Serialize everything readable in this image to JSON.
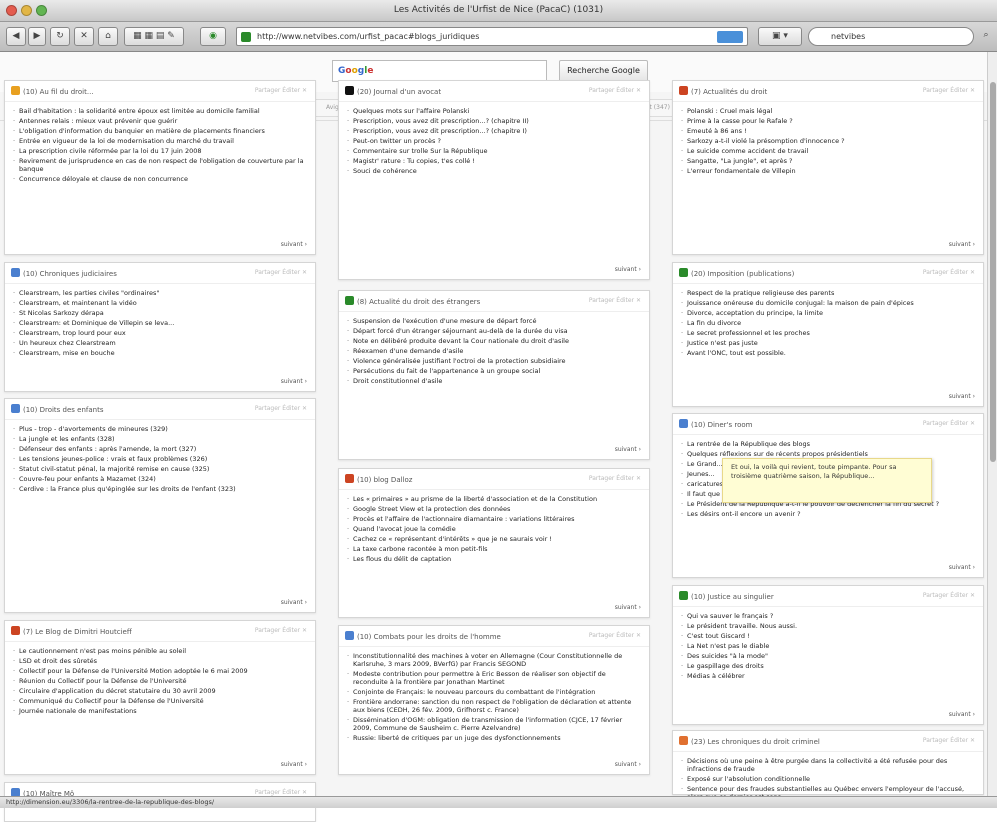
{
  "window": {
    "title": "Les Activités de l'Urfist de Nice (PacaC) (1031)"
  },
  "browser": {
    "url": "http://www.netvibes.com/urfist_pacac#blogs_juridiques",
    "search": "netvibes"
  },
  "google": {
    "placeholder": "Google",
    "button": "Recherche Google"
  },
  "tabs": [
    "Accueil (73)",
    "SIG (26)",
    "SPI (93)",
    "SHS (198)",
    "Marseille 1",
    "Nice",
    "Marseille",
    "Avignon",
    "Toulon",
    "Corte",
    "blogs_juridiques (303)",
    "droit (347)",
    "+"
  ],
  "tab_edit": "Éditer",
  "widgets": [
    {
      "title": "(10) Au fil du droit...",
      "items": [
        "Bail d'habitation : la solidarité entre époux est limitée au domicile familial",
        "Antennes relais : mieux vaut prévenir que guérir",
        "L'obligation d'information du banquier en matière de placements financiers",
        "Entrée en vigueur de la loi de modernisation du marché du travail",
        "La prescription civile réformée par la loi du 17 juin 2008",
        "Revirement de jurisprudence en cas de non respect de l'obligation de couverture par la banque",
        "Concurrence déloyale et clause de non concurrence"
      ]
    },
    {
      "title": "(10) Chroniques judiciaires",
      "items": [
        "Clearstream, les parties civiles \"ordinaires\"",
        "Clearstream, et maintenant la vidéo",
        "St Nicolas Sarkozy dérapa",
        "Clearstream: et Dominique de Villepin se leva...",
        "Clearstream, trop lourd pour eux",
        "Un heureux chez Clearstream",
        "Clearstream, mise en bouche"
      ]
    },
    {
      "title": "(10) Droits des enfants",
      "items": [
        "Plus - trop - d'avortements de mineures (329)",
        "La jungle et les enfants (328)",
        "Défenseur des enfants : après l'amende, la mort (327)",
        "Les tensions jeunes-police : vrais et faux problèmes (326)",
        "Statut civil-statut pénal, la majorité remise en cause (325)",
        "Couvre-feu pour enfants à Mazamet (324)",
        "Cerdive : la France plus qu'épinglée sur les droits de l'enfant (323)"
      ]
    },
    {
      "title": "(7) Le Blog de Dimitri Houtcieff",
      "items": [
        "Le cautionnement n'est pas moins pénible au soleil",
        "LSD et droit des sûretés",
        "Collectif pour la Défense de l'Université Motion adoptée le 6 mai 2009",
        "Réunion du Collectif pour la Défense de l'Université",
        "Circulaire d'application du décret statutaire du 30 avril 2009",
        "Communiqué du Collectif pour la Défense de l'Université",
        "Journée nationale de manifestations"
      ]
    },
    {
      "title": "(20) Journal d'un avocat",
      "items": [
        "Quelques mots sur l'affaire Polanski",
        "Prescription, vous avez dit prescription...? (chapitre II)",
        "Prescription, vous avez dit prescription...? (chapitre I)",
        "Peut-on twitter un procès ?",
        "Commentaire sur trolle Sur la République",
        "Magistr' rature : Tu copies, t'es collé !",
        "Souci de cohérence"
      ]
    },
    {
      "title": "(8) Actualité du droit des étrangers",
      "items": [
        "Suspension de l'exécution d'une mesure de départ forcé",
        "Départ forcé d'un étranger séjournant au-delà de la durée du visa",
        "Note en délibéré produite devant la Cour nationale du droit d'asile",
        "Réexamen d'une demande d'asile",
        "Violence généralisée justifiant l'octroi de la protection subsidiaire",
        "Persécutions du fait de l'appartenance à un groupe social",
        "Droit constitutionnel d'asile"
      ]
    },
    {
      "title": "(10) blog Dalloz",
      "items": [
        "Les « primaires » au prisme de la liberté d'association et de la Constitution",
        "Google Street View et la protection des données",
        "Procès et l'affaire de l'actionnaire diamantaire : variations littéraires",
        "Quand l'avocat joue la comédie",
        "Cachez ce « représentant d'intérêts » que je ne saurais voir !",
        "La taxe carbone racontée à mon petit-fils",
        "Les flous du délit de captation"
      ]
    },
    {
      "title": "(10) Combats pour les droits de l'homme",
      "items": [
        "Inconstitutionnalité des machines à voter en Allemagne (Cour Constitutionnelle de Karlsruhe, 3 mars 2009, BVerfG) par Francis SEGOND",
        "Modeste contribution pour permettre à Eric Besson de réaliser son objectif de reconduite à la frontière par Jonathan Martinet",
        "Conjointe de Français: le nouveau parcours du combattant de l'intégration",
        "Frontière andorrane: sanction du non respect de l'obligation de déclaration et attente aux biens (CEDH, 26 fév. 2009, Grifhorst c. France)",
        "Dissémination d'OGM: obligation de transmission de l'information (CJCE, 17 février 2009, Commune de Sausheim c. Pierre Azelvandre)",
        "Russie: liberté de critiques par un juge des dysfonctionnements"
      ]
    },
    {
      "title": "(7) Actualités du droit",
      "items": [
        "Polanski : Cruel mais légal",
        "Prime à la casse pour le Rafale ?",
        "Emeuté à 86 ans !",
        "Sarkozy a-t-il violé la présomption d'innocence ?",
        "Le suicide comme accident de travail",
        "Sangatte, \"La jungle\", et après ?",
        "L'erreur fondamentale de Villepin"
      ]
    },
    {
      "title": "(20) Imposition (publications)",
      "items": [
        "Respect de la pratique religieuse des parents",
        "Jouissance onéreuse du domicile conjugal: la maison de pain d'épices",
        "Divorce, acceptation du principe, la limite",
        "La fin du divorce",
        "Le secret professionnel et les proches",
        "Justice n'est pas juste",
        "Avant l'ONC, tout est possible."
      ]
    },
    {
      "title": "(10) Diner's room",
      "items": [
        "La rentrée de la République des blogs",
        "Quelques réflexions sur de récents propos présidentiels",
        "Le Grand...",
        "Jeunes...",
        "caricatures...",
        "Il faut que tout change pour que rien ne change",
        "Le Président de la République a-t-il le pouvoir de déclencher la fin du secret ?",
        "Les désirs ont-il encore un avenir ?"
      ]
    },
    {
      "title": "(10) Justice au singulier",
      "items": [
        "Qui va sauver le français ?",
        "Le président travaille. Nous aussi.",
        "C'est tout Giscard !",
        "La Net n'est pas le diable",
        "Des suicides \"à la mode\"",
        "Le gaspillage des droits",
        "Médias à célébrer"
      ]
    },
    {
      "title": "(23) Les chroniques du droit criminel",
      "items": [
        "Décisions où une peine à être purgée dans la collectivité a été refusée pour des infractions de fraude",
        "Exposé sur l'absolution conditionnelle",
        "Sentence pour des fraudes substantielles au Québec envers l'employeur de l'accusé, alors que ce dernier est sans"
      ]
    },
    {
      "title": "(10) Maître Mô",
      "items": []
    }
  ],
  "widget_labels": {
    "next": "suivant ›",
    "share": "Partager",
    "edit": "Éditer"
  },
  "tooltip": "Et oui, la voilà qui revient, toute pimpante. Pour sa troisième quatrième saison, la République...",
  "status": "http://dimension.eu/3306/la-rentree-de-la-republique-des-blogs/",
  "colors": {
    "accent": "#3366cc",
    "tab_active": "#fff8d0",
    "tooltip": "#fffdd4"
  }
}
